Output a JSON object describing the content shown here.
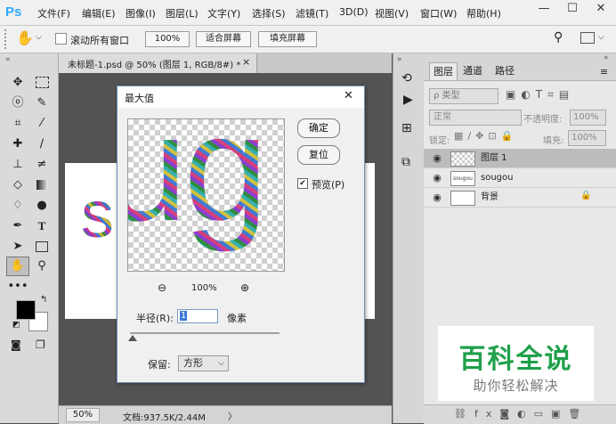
{
  "app": {
    "logo": "Ps"
  },
  "menu": [
    "文件(F)",
    "编辑(E)",
    "图像(I)",
    "图层(L)",
    "文字(Y)",
    "选择(S)",
    "滤镜(T)",
    "3D(D)",
    "视图(V)",
    "窗口(W)",
    "帮助(H)"
  ],
  "window_controls": {
    "minimize": "—",
    "maximize": "☐",
    "close": "✕"
  },
  "options_bar": {
    "scroll_all_label": "滚动所有窗口",
    "zoom_value": "100%",
    "fit_screen": "适合屏幕",
    "fill_screen": "填充屏幕"
  },
  "document": {
    "tab_title": "未标题-1.psd @ 50% (图层 1, RGB/8#) *",
    "tab_close": "×",
    "canvas_text": "s"
  },
  "status": {
    "zoom": "50%",
    "doc_info": "文档:937.5K/2.44M",
    "arrow": "〉"
  },
  "layers_panel": {
    "tabs": [
      "图层",
      "通道",
      "路径"
    ],
    "filter_kind": "ρ 类型",
    "blend_mode": "正常",
    "opacity_label": "不透明度:",
    "opacity_value": "100%",
    "lock_label": "锁定:",
    "fill_label": "填充:",
    "fill_value": "100%",
    "layers": [
      {
        "name": "图层 1",
        "thumb_text": ""
      },
      {
        "name": "sougou",
        "thumb_text": "sougou"
      },
      {
        "name": "背景",
        "thumb_text": ""
      }
    ]
  },
  "dialog": {
    "title": "最大值",
    "ok": "确定",
    "reset": "复位",
    "preview_label": "预览(P)",
    "preview_text": "ug",
    "zoom_percent": "100%",
    "radius_label": "半径(R):",
    "radius_value": "1",
    "radius_unit": "像素",
    "preserve_label": "保留:",
    "preserve_value": "方形"
  },
  "watermark": {
    "title": "百科全说",
    "subtitle": "助你轻松解决"
  },
  "colors": {
    "ps_blue": "#31a8ff",
    "watermark_green": "#1fa04a",
    "workspace": "#535353",
    "selected_layer": "#bcbcbc"
  }
}
